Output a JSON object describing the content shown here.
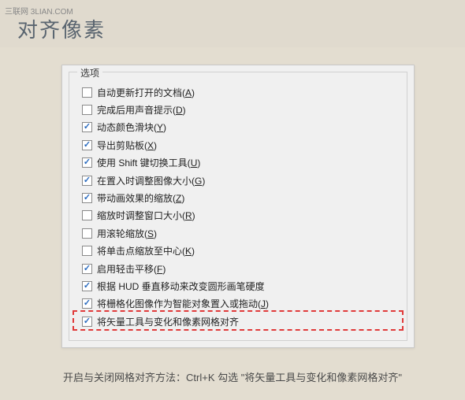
{
  "watermark": "三联网 3LIAN.COM",
  "title": "对齐像素",
  "panel": {
    "legend": "选项",
    "options": [
      {
        "checked": false,
        "label": "自动更新打开的文档(",
        "accel": "A",
        "suffix": ")"
      },
      {
        "checked": false,
        "label": "完成后用声音提示(",
        "accel": "D",
        "suffix": ")"
      },
      {
        "checked": true,
        "label": "动态颜色滑块(",
        "accel": "Y",
        "suffix": ")"
      },
      {
        "checked": true,
        "label": "导出剪贴板(",
        "accel": "X",
        "suffix": ")"
      },
      {
        "checked": true,
        "label": "使用 Shift 键切换工具(",
        "accel": "U",
        "suffix": ")"
      },
      {
        "checked": true,
        "label": "在置入时调整图像大小(",
        "accel": "G",
        "suffix": ")"
      },
      {
        "checked": true,
        "label": "带动画效果的缩放(",
        "accel": "Z",
        "suffix": ")"
      },
      {
        "checked": false,
        "label": "缩放时调整窗口大小(",
        "accel": "R",
        "suffix": ")"
      },
      {
        "checked": false,
        "label": "用滚轮缩放(",
        "accel": "S",
        "suffix": ")"
      },
      {
        "checked": false,
        "label": "将单击点缩放至中心(",
        "accel": "K",
        "suffix": ")"
      },
      {
        "checked": true,
        "label": "启用轻击平移(",
        "accel": "F",
        "suffix": ")"
      },
      {
        "checked": true,
        "label": "根据 HUD 垂直移动来改变圆形画笔硬度",
        "accel": "",
        "suffix": ""
      },
      {
        "checked": true,
        "label": "将栅格化图像作为智能对象置入或拖动(",
        "accel": "J",
        "suffix": ")"
      },
      {
        "checked": true,
        "label": "将矢量工具与变化和像素网格对齐",
        "accel": "",
        "suffix": ""
      }
    ],
    "highlight_index": 13
  },
  "footer": {
    "prefix": "开启与关闭网格对齐方法：Ctrl+K 勾选  ",
    "quoted": "\"将矢量工具与变化和像素网格对齐\""
  }
}
